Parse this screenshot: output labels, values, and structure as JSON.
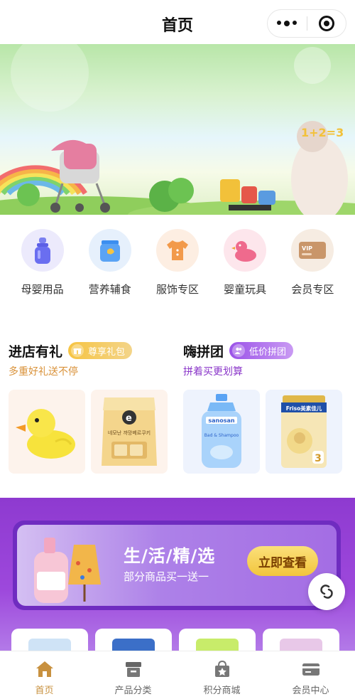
{
  "navbar": {
    "title": "首页"
  },
  "categories": [
    {
      "label": "母婴用品",
      "icon": "baby-bottle-icon"
    },
    {
      "label": "营养辅食",
      "icon": "formula-can-icon"
    },
    {
      "label": "服饰专区",
      "icon": "baby-clothes-icon"
    },
    {
      "label": "婴童玩具",
      "icon": "rubber-duck-icon"
    },
    {
      "label": "会员专区",
      "icon": "vip-card-icon"
    }
  ],
  "promo_left": {
    "title": "进店有礼",
    "tag": "尊享礼包",
    "subtitle": "多重好礼送不停"
  },
  "promo_right": {
    "title": "嗨拼团",
    "tag": "低价拼团",
    "subtitle": "拼着买更划算"
  },
  "products": {
    "cookie_label": "e",
    "cookie_text": "네모난 까망베르쿠키",
    "lotion_brand": "sanosan",
    "lotion_text": "Bad & Shampoo",
    "formula_brand": "Friso美素佳儿",
    "formula_stage": "3"
  },
  "banner": {
    "sign_text": "1+2=3"
  },
  "life_banner": {
    "title": "生/活/精/选",
    "subtitle": "部分商品买一送一",
    "button": "立即查看"
  },
  "tabbar": [
    {
      "label": "首页",
      "icon": "home-icon",
      "active": true
    },
    {
      "label": "产品分类",
      "icon": "category-icon",
      "active": false
    },
    {
      "label": "积分商城",
      "icon": "points-mall-icon",
      "active": false
    },
    {
      "label": "会员中心",
      "icon": "member-card-icon",
      "active": false
    }
  ],
  "colors": {
    "accent_gold": "#c8913f",
    "purple": "#9d48dc",
    "gold_tag": "#f6c443"
  }
}
